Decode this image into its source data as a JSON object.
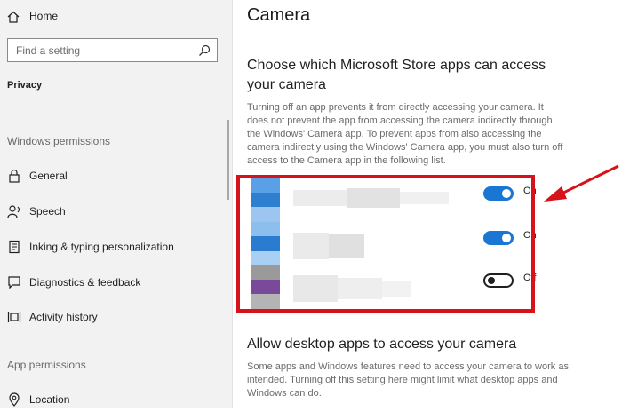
{
  "sidebar": {
    "home_label": "Home",
    "search_placeholder": "Find a setting",
    "category": "Privacy",
    "windows_permissions_title": "Windows permissions",
    "windows_items": [
      {
        "label": "General",
        "icon": "lock-icon"
      },
      {
        "label": "Speech",
        "icon": "speech-icon"
      },
      {
        "label": "Inking & typing personalization",
        "icon": "inking-icon"
      },
      {
        "label": "Diagnostics & feedback",
        "icon": "feedback-icon"
      },
      {
        "label": "Activity history",
        "icon": "activity-history-icon"
      }
    ],
    "app_permissions_title": "App permissions",
    "app_items": [
      {
        "label": "Location",
        "icon": "location-icon"
      }
    ]
  },
  "main": {
    "title": "Camera",
    "store_heading": "Choose which Microsoft Store apps can access your camera",
    "store_description": "Turning off an app prevents it from directly accessing your camera. It does not prevent the app from accessing the camera indirectly through the Windows' Camera app. To prevent apps from also accessing the camera indirectly using the Windows' Camera app, you must also turn off access to the Camera app in the following list.",
    "apps": [
      {
        "toggle_state": "On",
        "enabled": true
      },
      {
        "toggle_state": "On",
        "enabled": true
      },
      {
        "toggle_state": "Off",
        "enabled": false
      }
    ],
    "desktop_heading": "Allow desktop apps to access your camera",
    "desktop_description": "Some apps and Windows features need to access your camera to work as intended. Turning off this setting here might limit what desktop apps and Windows can do."
  },
  "colors": {
    "accent": "#1976d2",
    "annotation_red": "#d6131a"
  }
}
